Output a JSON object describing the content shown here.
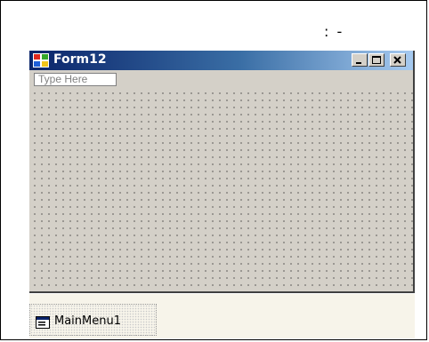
{
  "header_text": ": -",
  "form": {
    "title": "Form12",
    "menu_placeholder": "Type Here"
  },
  "tray": {
    "component_label": "MainMenu1"
  },
  "colors": {
    "title_start": "#0a246a",
    "title_end": "#a6caf0",
    "form_bg": "#d4d0c8",
    "tray_bg": "#f7f4ea"
  },
  "icons": {
    "form_icon": "windows-form-icon",
    "minimize": "minimize-icon",
    "maximize": "maximize-icon",
    "close": "close-icon",
    "tray_icon": "main-menu-icon"
  }
}
